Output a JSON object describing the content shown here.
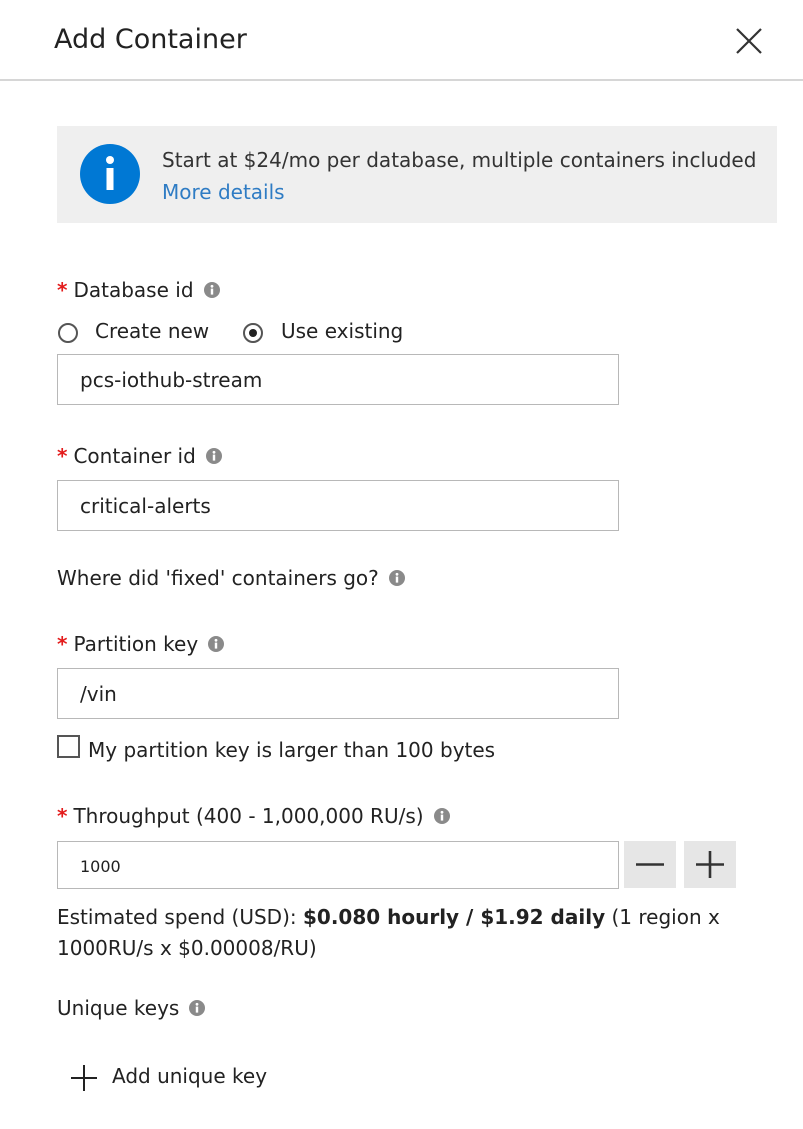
{
  "panel": {
    "title": "Add Container",
    "close_icon": "close-icon"
  },
  "banner": {
    "message": "Start at $24/mo per database, multiple containers included",
    "link": "More details",
    "icon": "info-circle-icon",
    "icon_color": "#0078d4"
  },
  "database": {
    "label": "Database id",
    "options": [
      "Create new",
      "Use existing"
    ],
    "selected": "Use existing",
    "value": "pcs-iothub-stream"
  },
  "container": {
    "label": "Container id",
    "value": "critical-alerts"
  },
  "fixed_question": "Where did 'fixed' containers go?",
  "partition": {
    "label": "Partition key",
    "value": "/vin",
    "large_key_label": "My partition key is larger than 100 bytes",
    "large_key_checked": false
  },
  "throughput": {
    "label": "Throughput (400 - 1,000,000 RU/s)",
    "value": "1000",
    "decrement": "minus-icon",
    "increment": "plus-icon"
  },
  "spend": {
    "prefix": "Estimated spend (USD): ",
    "bold": "$0.080 hourly / $1.92 daily",
    "suffix": " (1 region x 1000RU/s x $0.00008/RU)"
  },
  "unique_keys": {
    "label": "Unique keys",
    "add_label": "Add unique key"
  },
  "colors": {
    "required": "#e31b1b",
    "link": "#2f7cc4",
    "banner_bg": "#efefef"
  }
}
